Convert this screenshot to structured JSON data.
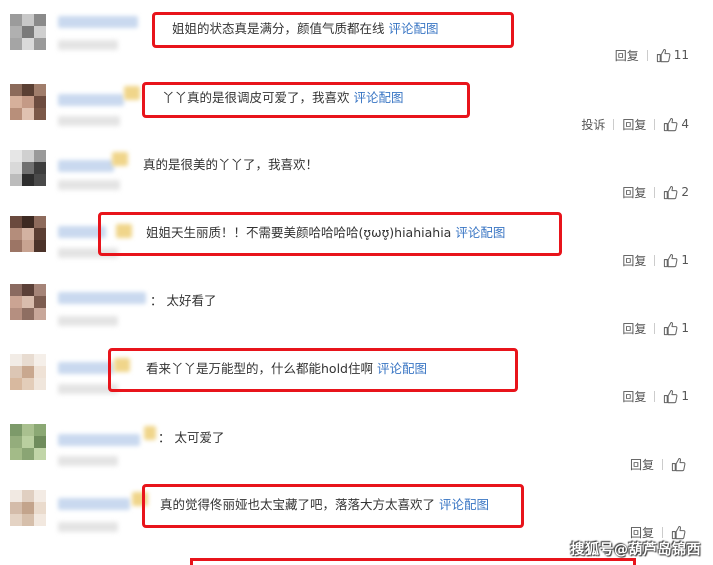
{
  "comments": [
    {
      "text": "姐姐的状态真是满分，颜值气质都在线",
      "link": "评论配图",
      "report": "",
      "reply": "回复",
      "likes": "11"
    },
    {
      "text": "丫丫真的是很调皮可爱了，我喜欢",
      "link": "评论配图",
      "report": "投诉",
      "reply": "回复",
      "likes": "4"
    },
    {
      "text": "真的是很美的丫丫了，我喜欢！",
      "link": "",
      "report": "",
      "reply": "回复",
      "likes": "2"
    },
    {
      "text": "姐姐天生丽质！！不需要美颜哈哈哈哈(ʊ̥ωʊ̥)hiahiahia",
      "link": "评论配图",
      "report": "",
      "reply": "回复",
      "likes": "1"
    },
    {
      "text": "：  太好看了",
      "link": "",
      "report": "",
      "reply": "回复",
      "likes": "1"
    },
    {
      "text": "看来丫丫是万能型的，什么都能hold住啊",
      "link": "评论配图",
      "report": "",
      "reply": "回复",
      "likes": "1"
    },
    {
      "text": "：  太可爱了",
      "link": "",
      "report": "",
      "reply": "回复",
      "likes": ""
    },
    {
      "text": "真的觉得佟丽娅也太宝藏了吧，落落大方太喜欢了",
      "link": "评论配图",
      "report": "",
      "reply": "回复",
      "likes": ""
    }
  ],
  "watermark": "搜狐号@葫芦岛锦西",
  "colors": {
    "highlight": "#e8141b",
    "link": "#3a76c4",
    "text": "#333333"
  },
  "icons": [
    "thumbs-up-icon",
    "blurred-avatar"
  ]
}
